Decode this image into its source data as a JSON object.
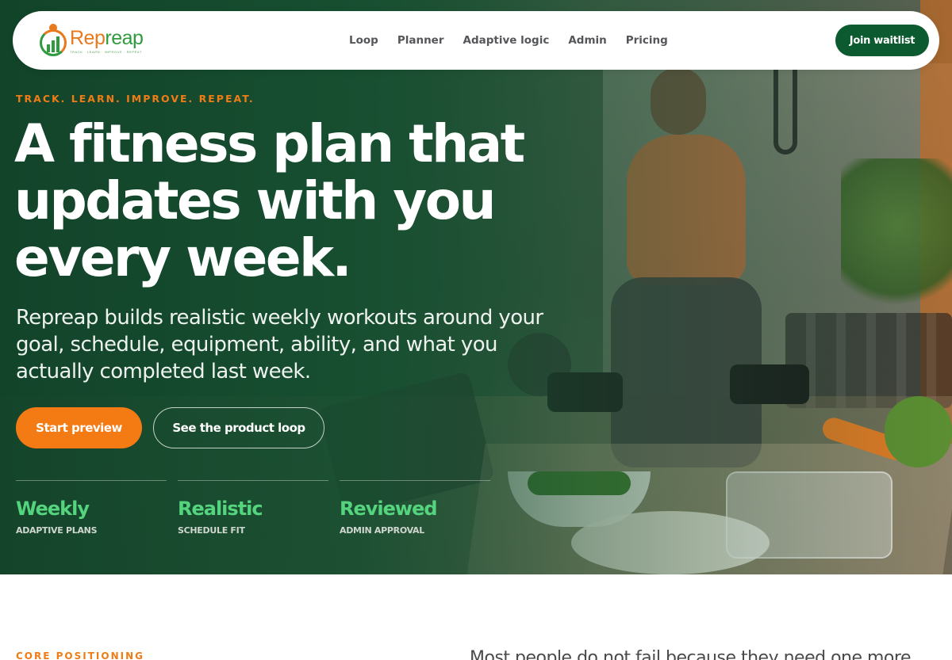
{
  "brand": {
    "name_part1": "Rep",
    "name_part2": "reap",
    "tagline": "TRACK · LEARN · IMPROVE · REPEAT",
    "accent_orange": "#f47a14",
    "accent_green": "#0c5a2f",
    "stat_green": "#55d47e"
  },
  "nav": {
    "links": [
      "Loop",
      "Planner",
      "Adaptive logic",
      "Admin",
      "Pricing"
    ],
    "cta": "Join waitlist"
  },
  "hero": {
    "eyebrow": "TRACK. LEARN. IMPROVE. REPEAT.",
    "headline_line1": "A fitness plan that",
    "headline_line2": "updates with you",
    "headline_line3": "every week.",
    "subhead": "Repreap builds realistic weekly workouts around your goal, schedule, equipment, ability, and what you actually completed last week.",
    "primary_button": "Start preview",
    "secondary_button": "See the product loop",
    "stats": [
      {
        "value": "Weekly",
        "label": "ADAPTIVE PLANS"
      },
      {
        "value": "Realistic",
        "label": "SCHEDULE FIT"
      },
      {
        "value": "Reviewed",
        "label": "ADMIN APPROVAL"
      }
    ]
  },
  "section": {
    "eyebrow": "CORE POSITIONING",
    "text": "Most people do not fail because they need one more"
  }
}
